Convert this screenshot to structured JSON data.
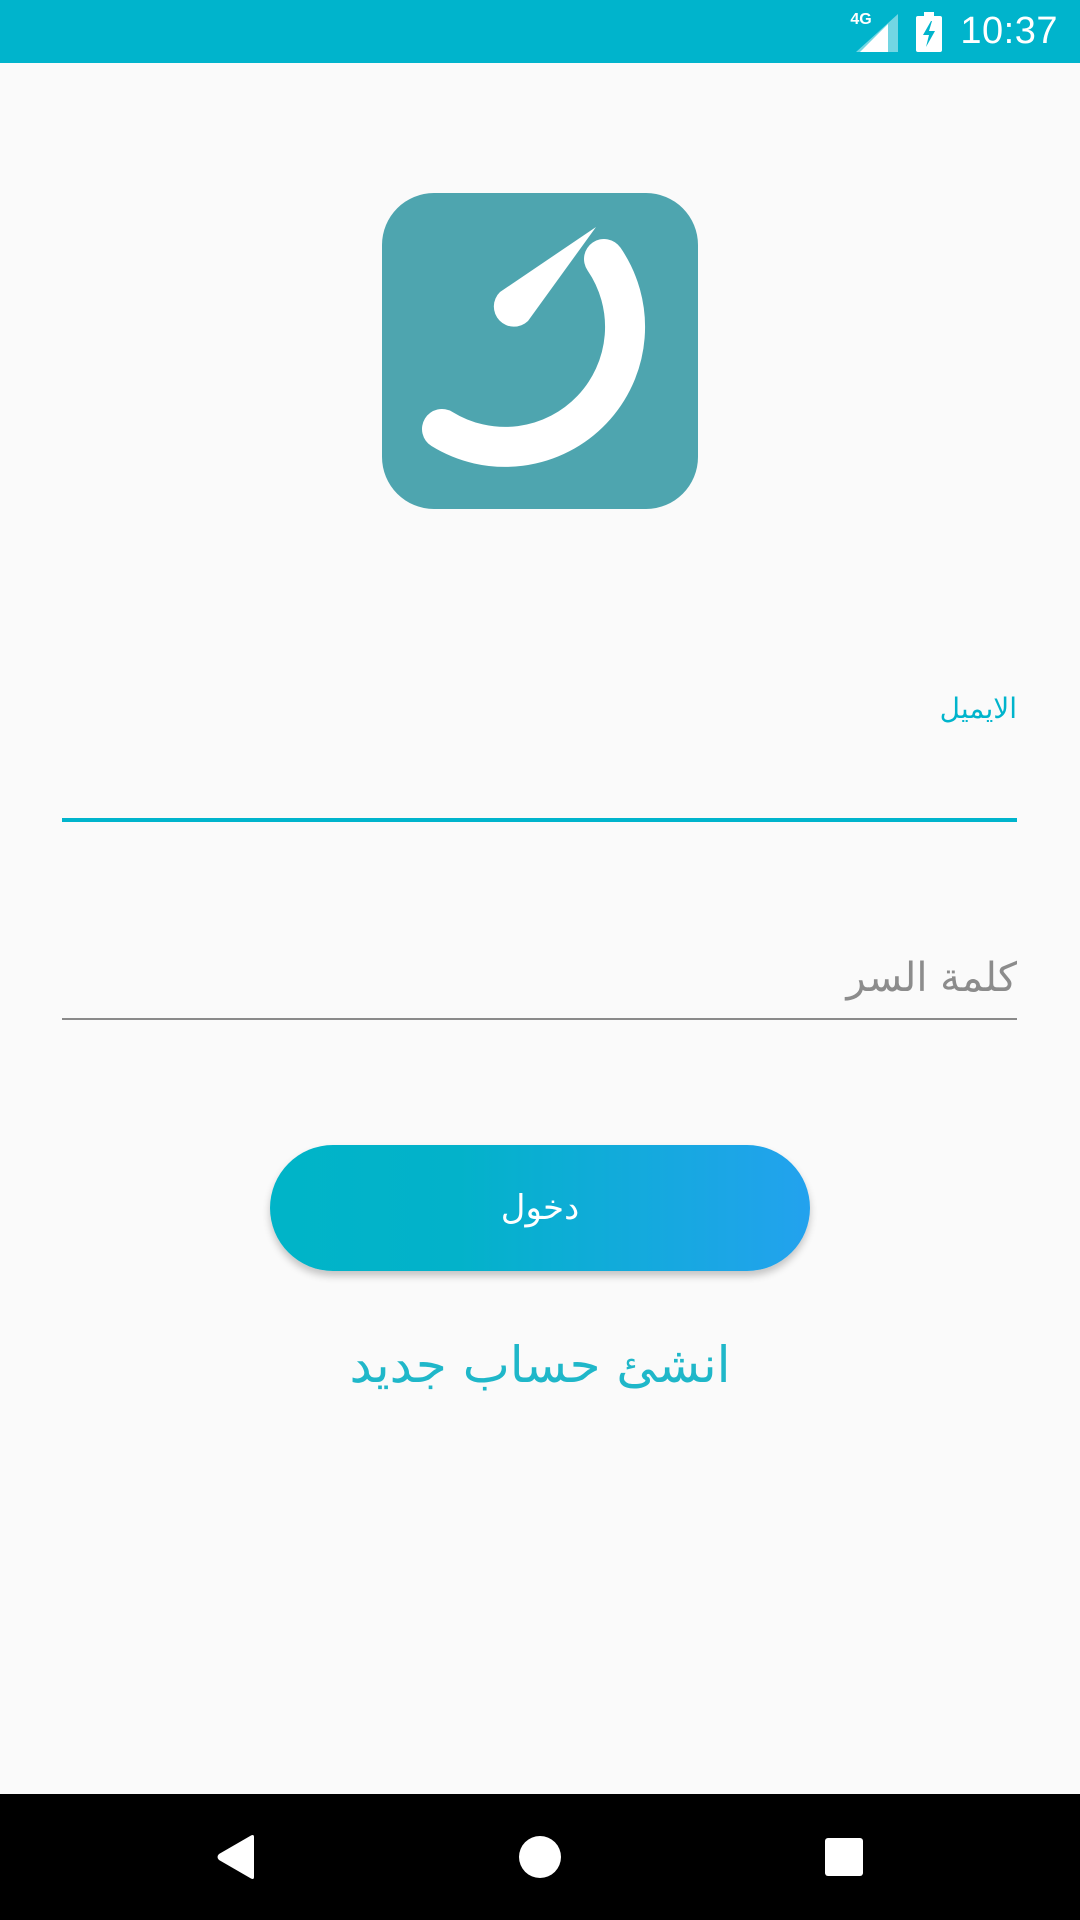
{
  "status_bar": {
    "network_type": "4G",
    "time": "10:37",
    "background_color": "#00B4CC"
  },
  "logo": {
    "background_color": "#4EA5AF",
    "icon": "dial-arc-logo-icon"
  },
  "login_form": {
    "email_label": "الايميل",
    "email_value": "",
    "password_placeholder": "كلمة السر",
    "password_value": "",
    "login_button_label": "دخول",
    "create_account_label": "انشئ حساب جديد",
    "accent_color": "#00B4CC"
  },
  "nav_bar": {
    "icons": [
      "back-icon",
      "home-icon",
      "recent-apps-icon"
    ]
  }
}
